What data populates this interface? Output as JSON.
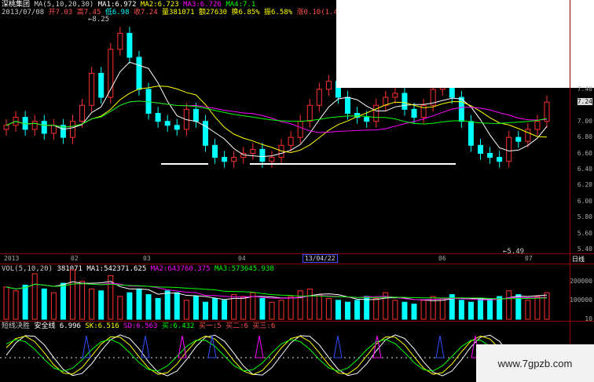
{
  "header": {
    "stock_name": "深桃集团",
    "ma_settings": "MA(5,10,20,30)",
    "ma1": "MA1:6.972",
    "ma2": "MA2:6.723",
    "ma3": "MA3:6.726",
    "ma4": "MA4:7.1",
    "date": "2013/07/08",
    "open": "开7.03",
    "high": "高7.45",
    "low": "低6.98",
    "close": "收7.24",
    "volume": "量381071",
    "amount": "额27630",
    "change": "换6.85%",
    "amp": "振6.58%",
    "rise": "涨0.10(1.4"
  },
  "price_axis": [
    "7.40",
    "7.24",
    "7.00",
    "6.80",
    "6.60",
    "6.40",
    "6.20",
    "6.00",
    "5.80",
    "5.60",
    "5.40"
  ],
  "time_axis": [
    "2013",
    "02",
    "03",
    "04",
    "13/04/22",
    "06",
    "07",
    "日线"
  ],
  "annotations": {
    "high_mark": "8.25",
    "low_mark": "5.49"
  },
  "volume_panel": {
    "title": "VOL(5,10,20)",
    "vol": "381071",
    "ma1": "MA1:542371.625",
    "ma2": "MA2:643760.375",
    "ma3": "MA3:573645.938",
    "axis": [
      "200000",
      "100000",
      "10"
    ]
  },
  "indicator_panel": {
    "title": "短线决胜",
    "safe_line": "安全线 6.996",
    "sk": "SK:6.516",
    "sd": "SD:6.563",
    "buy": "买:6.432",
    "low1": "买一:5",
    "low2": "买二:6",
    "low3": "买三:6"
  },
  "watermark": "www.7gpzb.com",
  "chart_data": {
    "type": "bar",
    "title": "",
    "xlabel": "",
    "ylabel": "",
    "ylim": [
      5.4,
      8.3
    ],
    "candles_close": [
      6.95,
      7.05,
      6.9,
      7.0,
      6.85,
      6.95,
      6.8,
      7.0,
      7.2,
      7.6,
      7.3,
      7.9,
      8.1,
      7.8,
      7.4,
      7.1,
      7.0,
      6.95,
      6.9,
      7.15,
      7.0,
      6.7,
      6.55,
      6.5,
      6.55,
      6.6,
      6.65,
      6.5,
      6.55,
      6.7,
      6.8,
      7.0,
      7.2,
      7.4,
      7.5,
      7.3,
      7.1,
      7.05,
      7.0,
      7.2,
      7.3,
      7.35,
      7.15,
      7.05,
      7.2,
      7.4,
      7.5,
      7.3,
      7.0,
      6.7,
      6.6,
      6.55,
      6.5,
      6.8,
      6.75,
      6.9,
      7.0,
      7.24
    ],
    "volume_values": [
      170000,
      150000,
      180000,
      240000,
      160000,
      140000,
      190000,
      260000,
      200000,
      160000,
      150000,
      230000,
      120000,
      140000,
      160000,
      130000,
      110000,
      150000,
      140000,
      100000,
      120000,
      90000,
      110000,
      100000,
      130000,
      120000,
      140000,
      110000,
      90000,
      100000,
      120000,
      150000,
      160000,
      130000,
      110000,
      100000,
      90000,
      100000,
      120000,
      110000,
      140000,
      100000,
      90000,
      80000,
      100000,
      120000,
      110000,
      130000,
      100000,
      90000,
      110000,
      100000,
      120000,
      150000,
      130000,
      100000,
      120000,
      140000
    ]
  }
}
